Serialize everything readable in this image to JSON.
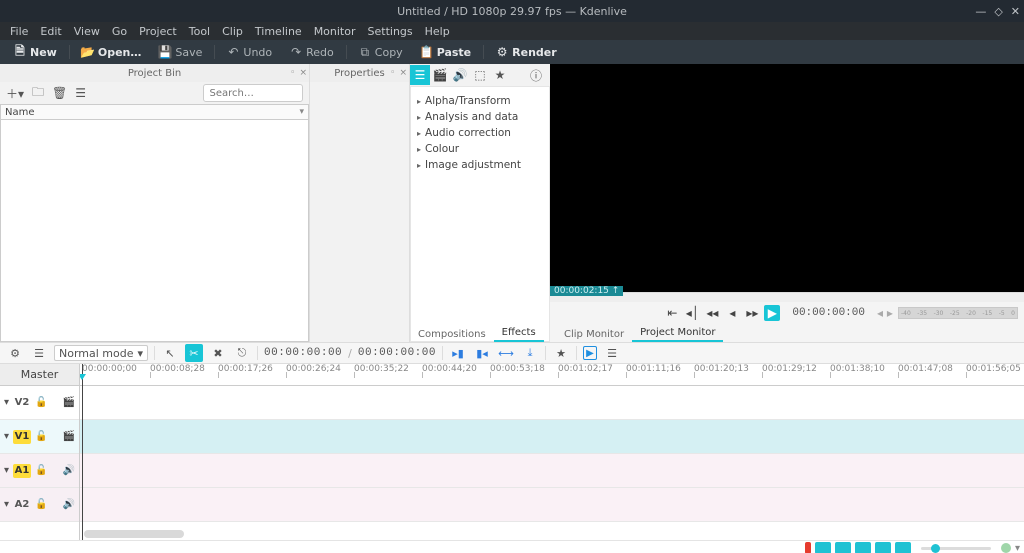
{
  "window": {
    "title": "Untitled / HD 1080p 29.97 fps — Kdenlive"
  },
  "menubar": [
    "File",
    "Edit",
    "View",
    "Go",
    "Project",
    "Tool",
    "Clip",
    "Timeline",
    "Monitor",
    "Settings",
    "Help"
  ],
  "toolbar": [
    {
      "icon": "file-new",
      "label": "New",
      "enabled": true
    },
    {
      "icon": "folder-open",
      "label": "Open…",
      "enabled": true
    },
    {
      "icon": "save",
      "label": "Save",
      "enabled": false
    },
    {
      "icon": "undo",
      "label": "Undo",
      "enabled": false
    },
    {
      "icon": "redo",
      "label": "Redo",
      "enabled": false
    },
    {
      "icon": "copy",
      "label": "Copy",
      "enabled": false
    },
    {
      "icon": "paste",
      "label": "Paste",
      "enabled": true
    },
    {
      "icon": "render",
      "label": "Render",
      "enabled": true
    }
  ],
  "bin": {
    "title": "Project Bin",
    "search_placeholder": "Search…",
    "column": "Name"
  },
  "props": {
    "title": "Properties"
  },
  "effects": {
    "categories": [
      "Alpha/Transform",
      "Analysis and data",
      "Audio correction",
      "Colour",
      "Image adjustment"
    ],
    "bottom_tabs": {
      "left": "Compositions",
      "right": "Effects",
      "active": "Effects"
    }
  },
  "monitor": {
    "timecode_badge": "00:00:02:15 ↑",
    "timecode": "00:00:00:00",
    "meter_ticks": [
      "-40",
      "-35",
      "-30",
      "-25",
      "-20",
      "-15",
      "-5",
      "0"
    ],
    "tabs": {
      "left": "Clip Monitor",
      "right": "Project Monitor",
      "active": "Project Monitor"
    }
  },
  "tl_toolbar": {
    "mode": "Normal mode",
    "pos": "00:00:00:00",
    "dur": "00:00:00:00"
  },
  "timeline": {
    "master": "Master",
    "tracks": [
      {
        "name": "V2",
        "type": "video",
        "active": false
      },
      {
        "name": "V1",
        "type": "video",
        "active": true
      },
      {
        "name": "A1",
        "type": "audio",
        "active": true
      },
      {
        "name": "A2",
        "type": "audio",
        "active": false
      }
    ],
    "ruler": [
      "00:00:00;00",
      "00:00:08;28",
      "00:00:17;26",
      "00:00:26;24",
      "00:00:35;22",
      "00:00:44;20",
      "00:00:53;18",
      "00:01:02;17",
      "00:01:11;16",
      "00:01:20;13",
      "00:01:29;12",
      "00:01:38;10",
      "00:01:47;08",
      "00:01:56;05"
    ]
  }
}
